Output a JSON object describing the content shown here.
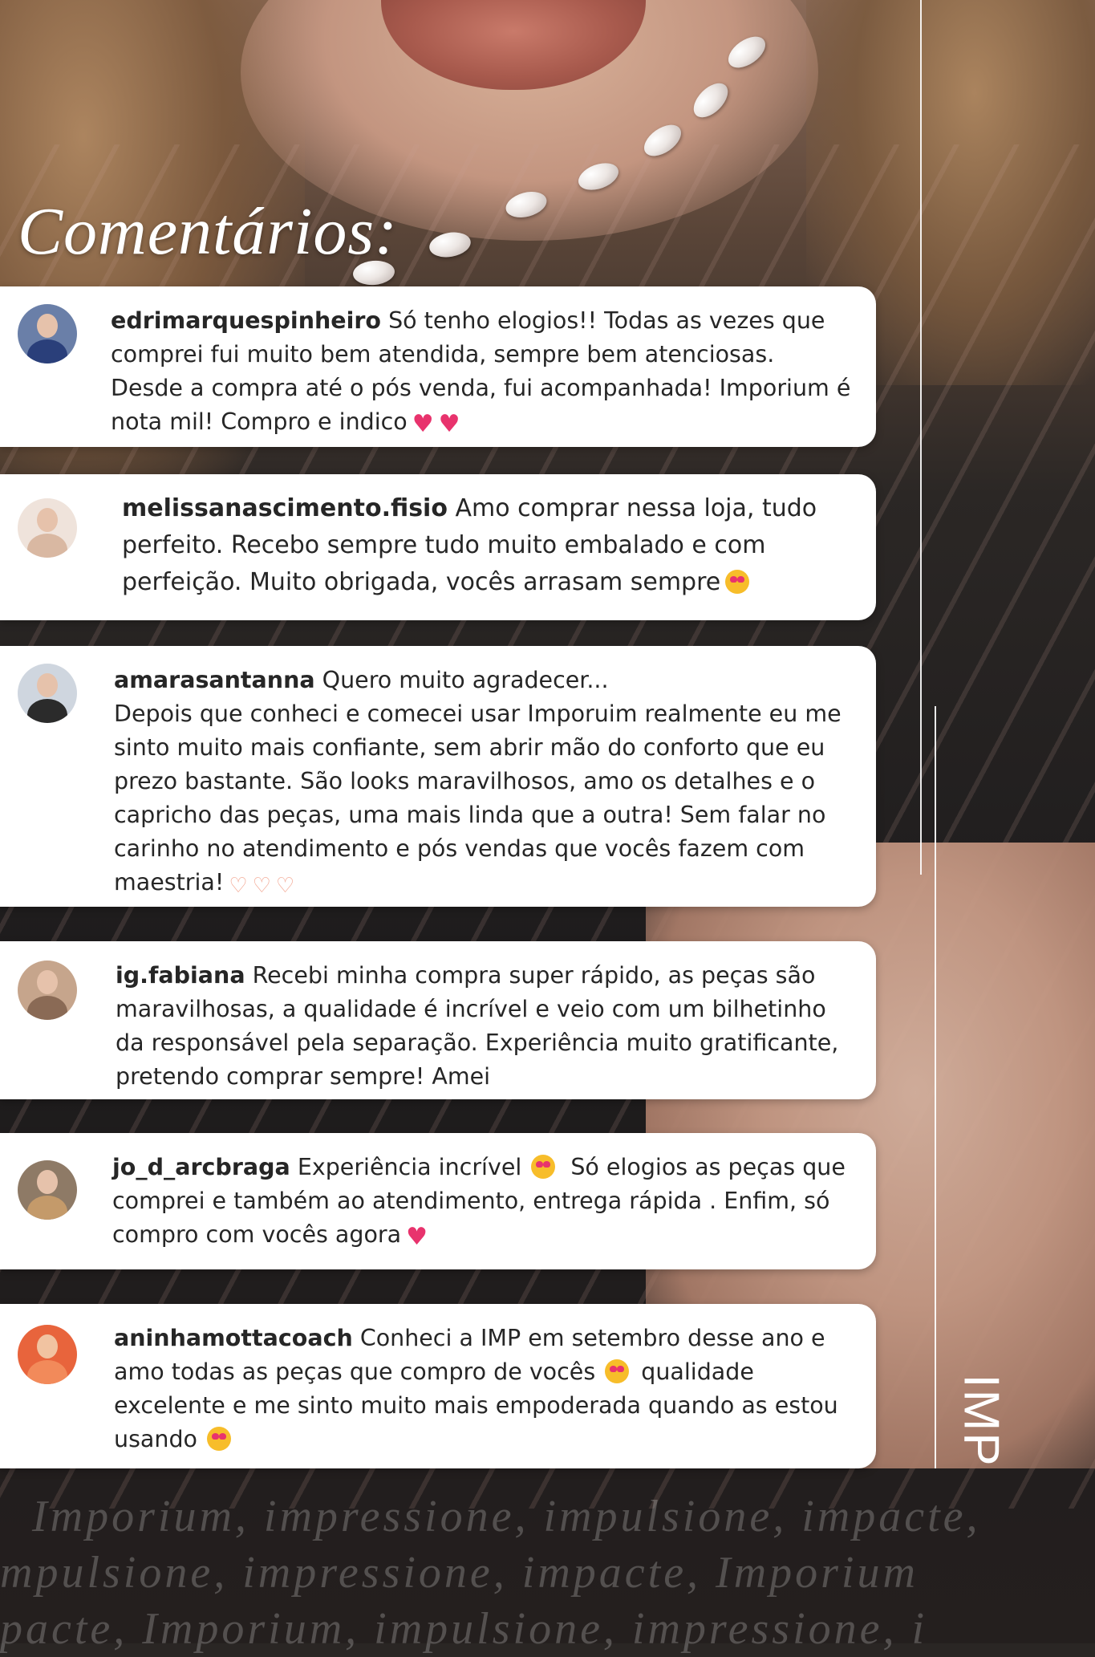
{
  "title": "Comentários:",
  "brand": "IMP",
  "tagline_lines": [
    "Imporium, impressione, impulsione, impacte,",
    "mpulsione, impressione, impacte, Imporium",
    "pacte, Imporium, impulsione, impressione, i"
  ],
  "comments": [
    {
      "username": "edrimarquespinheiro",
      "text": "Só tenho elogios!! Todas as vezes que comprei fui muito bem atendida, sempre bem atenciosas. Desde a compra até o pós venda, fui acompanhada! Imporium é nota mil! Compro e indico",
      "emoji": "heart-icon heart-icon"
    },
    {
      "username": "melissanascimento.fisio",
      "text": "Amo comprar nessa loja, tudo perfeito. Recebo sempre tudo muito embalado e com perfeição. Muito obrigada, vocês arrasam sempre",
      "emoji": "heart-eyes-icon"
    },
    {
      "username": "amarasantanna",
      "text_first": "Quero muito agradecer...",
      "text": "Depois que conheci e comecei usar Imporuim realmente eu me sinto muito mais confiante, sem abrir mão do conforto que eu prezo bastante. São looks maravilhosos, amo os detalhes e o capricho das peças, uma mais linda que a outra! Sem falar no carinho no atendimento e pós vendas que vocês fazem com maestria!",
      "emoji": "heart-hands-icon heart-hands-icon heart-hands-icon"
    },
    {
      "username": "ig.fabiana",
      "text": "Recebi minha compra super rápido, as peças são maravilhosas, a qualidade é incrível e veio com um bilhetinho da responsável pela separação. Experiência muito gratificante, pretendo comprar sempre! Amei"
    },
    {
      "username": "jo_d_arcbraga",
      "text_first": "Experiência incrível",
      "text": "Só elogios as peças que comprei e também ao atendimento, entrega rápida . Enfim, só compro com vocês agora",
      "emoji": "heart-eyes-icon heart-icon"
    },
    {
      "username": "aninhamottacoach",
      "text_first": "Conheci a IMP em setembro desse ano e amo todas as peças que compro de vocês",
      "text": "qualidade excelente e me sinto muito mais empoderada quando as estou usando",
      "emoji": "heart-eyes-icon heart-eyes-icon"
    }
  ],
  "colors": {
    "card_bg": "#ffffff",
    "text": "#262626",
    "heart": "#e8336d",
    "title": "#ffffff"
  }
}
